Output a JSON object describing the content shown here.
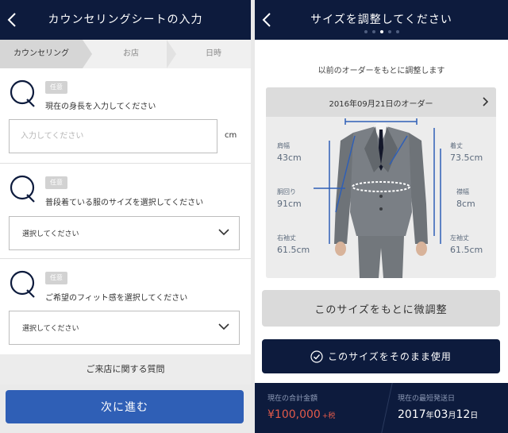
{
  "left_screen": {
    "title": "カウンセリングシートの入力",
    "steps": [
      "カウンセリング",
      "お店",
      "日時"
    ],
    "questions": [
      {
        "tag": "任意",
        "text": "現在の身長を入力してください",
        "placeholder": "入力してください",
        "unit": "cm"
      },
      {
        "tag": "任意",
        "text": "普段着ている服のサイズを選択してください",
        "select_value": "選択してください"
      },
      {
        "tag": "任意",
        "text": "ご希望のフィット感を選択してください",
        "select_value": "選択してください"
      }
    ],
    "section_heading": "ご来店に関する質問",
    "next_button": "次に進む"
  },
  "right_screen": {
    "title": "サイズを調整してください",
    "page_dots": {
      "count": 5,
      "active_index": 2
    },
    "info_text": "以前のオーダーをもとに調整します",
    "order_selector": "2016年09月21日のオーダー",
    "measurements_left": [
      {
        "label": "肩幅",
        "value": "43cm"
      },
      {
        "label": "胴回り",
        "value": "91cm"
      },
      {
        "label": "右袖丈",
        "value": "61.5cm"
      }
    ],
    "measurements_right": [
      {
        "label": "着丈",
        "value": "73.5cm"
      },
      {
        "label": "襟幅",
        "value": "8cm"
      },
      {
        "label": "左袖丈",
        "value": "61.5cm"
      }
    ],
    "adjust_button": "このサイズをもとに微調整",
    "use_button": "このサイズをそのまま使用",
    "footer": {
      "total_label": "現在の合計金額",
      "total_value": "¥100,000",
      "tax_label": "+税",
      "ship_label": "現在の最短発送日",
      "ship_year": "2017",
      "ship_year_unit": "年",
      "ship_month": "03",
      "ship_month_unit": "月",
      "ship_day": "12",
      "ship_day_unit": "日"
    }
  },
  "colors": {
    "navy": "#0d1b3d",
    "primary_blue": "#2f5fb6",
    "price_red": "#e25a4a",
    "tag_gray": "#d2d2d2"
  },
  "icons": [
    "back-arrow-icon",
    "q-icon",
    "chevron-down-icon",
    "chevron-right-icon",
    "check-circle-icon",
    "suit-image"
  ]
}
